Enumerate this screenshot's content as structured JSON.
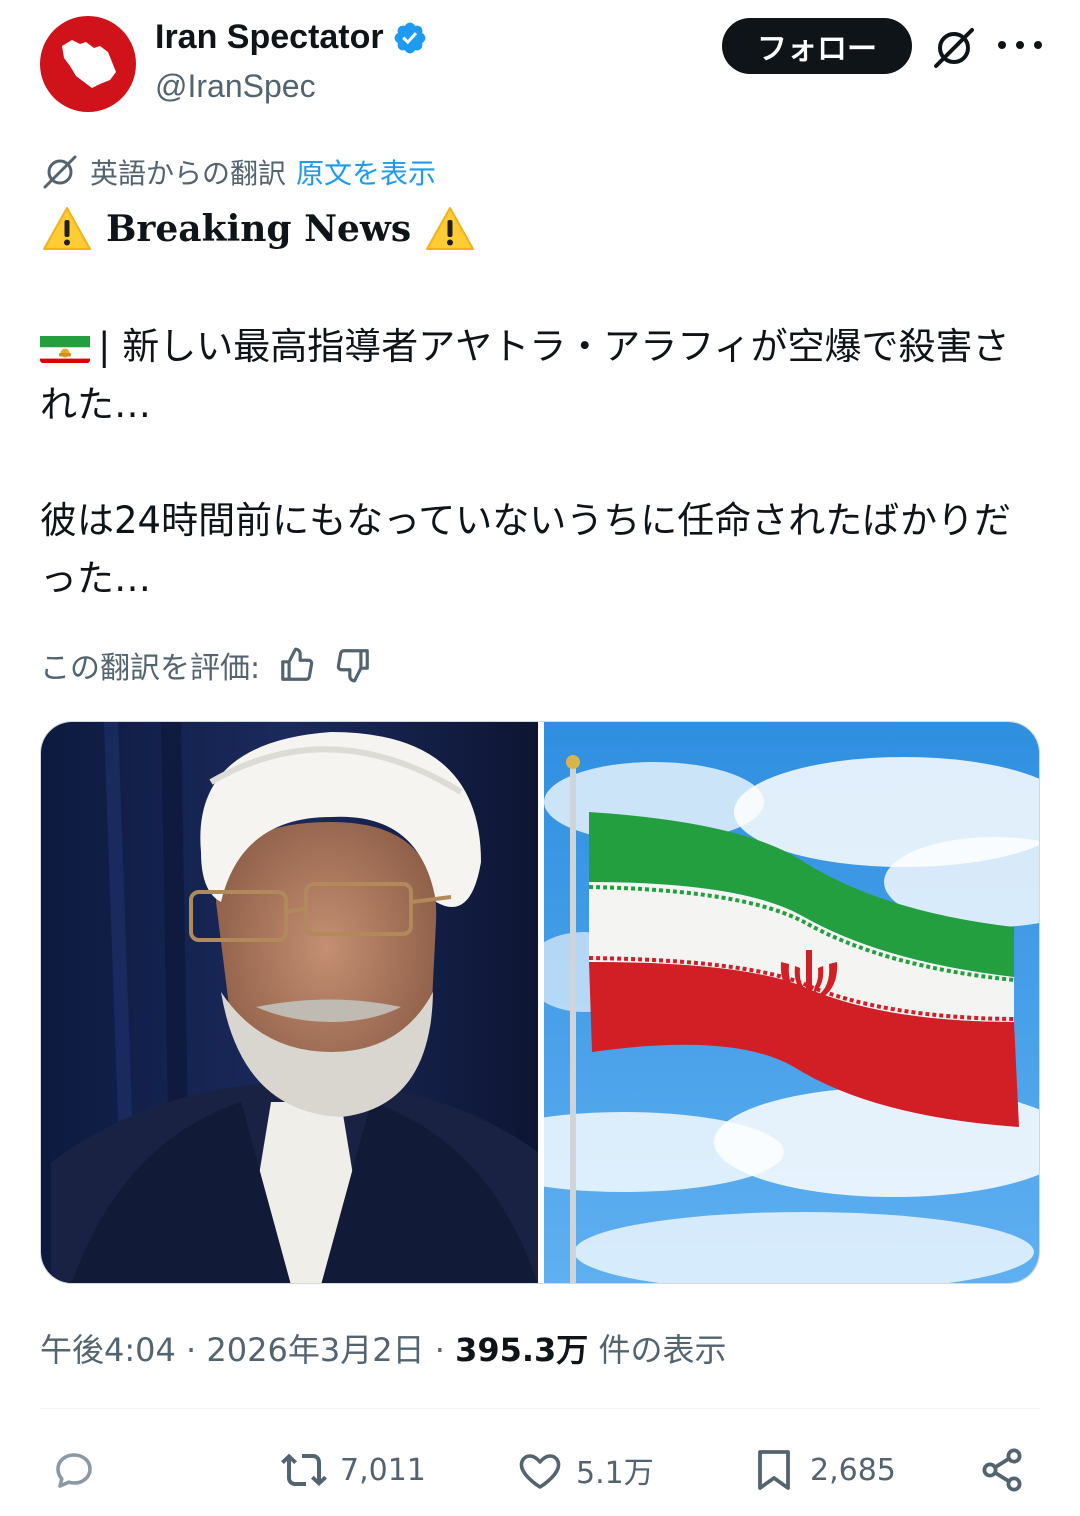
{
  "header": {
    "display_name": "Iran Spectator",
    "handle": "@IranSpec",
    "follow_label": "フォロー",
    "verified": true
  },
  "translation": {
    "note": "英語からの翻訳",
    "show_original": "原文を表示"
  },
  "post": {
    "breaking": "Breaking News",
    "line1": "| 新しい最高指導者アヤトラ・アラフィが空爆で殺害された…",
    "line2": "彼は24時間前にもなっていないうちに任命されたばかりだった…"
  },
  "rate_translation": "この翻訳を評価:",
  "meta": {
    "time": "午後4:04",
    "sep1": " · ",
    "date": "2026年3月2日",
    "sep2": " · ",
    "views": "395.3万",
    "views_suffix": " 件の表示"
  },
  "actions": {
    "retweets": "7,011",
    "likes": "5.1万",
    "bookmarks": "2,685"
  },
  "colors": {
    "accent": "#1d9bf0",
    "avatar_bg": "#d0131a",
    "text_primary": "#0f1419",
    "text_secondary": "#536471"
  }
}
